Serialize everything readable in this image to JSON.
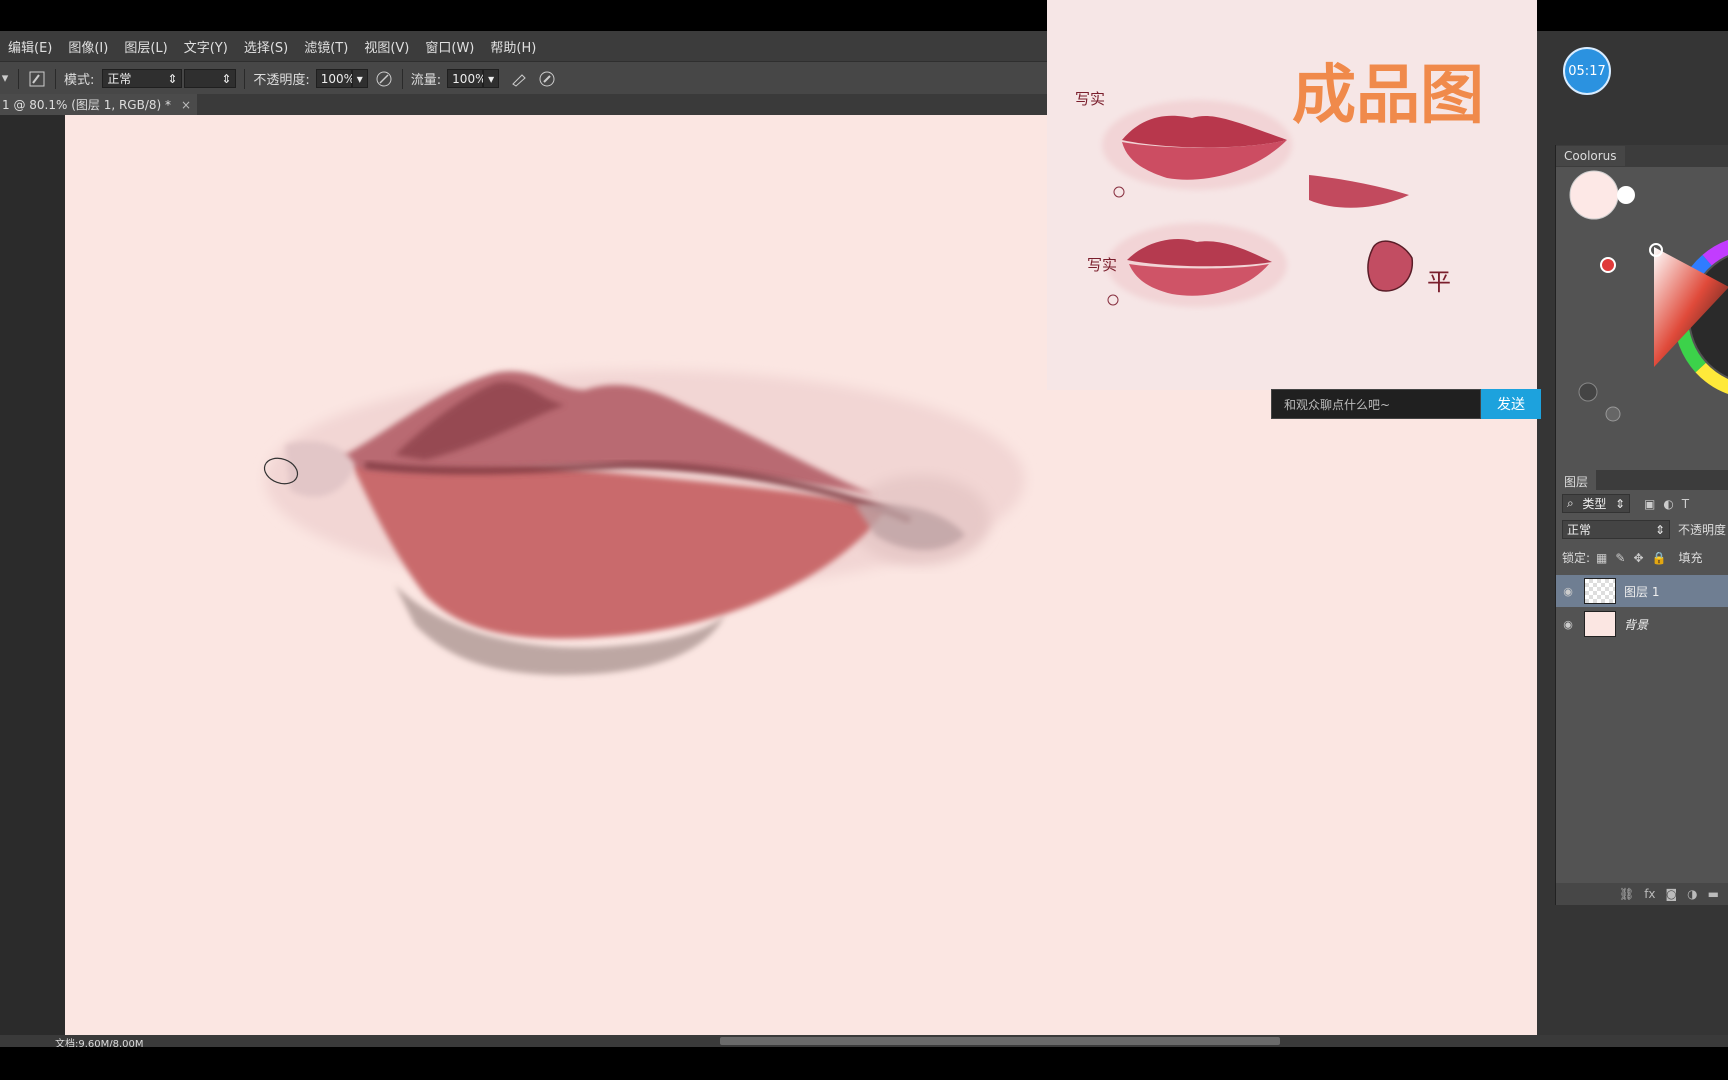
{
  "menu": [
    "编辑(E)",
    "图像(I)",
    "图层(L)",
    "文字(Y)",
    "选择(S)",
    "滤镜(T)",
    "视图(V)",
    "窗口(W)",
    "帮助(H)"
  ],
  "options": {
    "mode_label": "模式:",
    "mode_value": "正常",
    "opacity_label": "不透明度:",
    "opacity_value": "100%",
    "flow_label": "流量:",
    "flow_value": "100%"
  },
  "document_tab": {
    "title": "1 @ 80.1% (图层 1, RGB/8) *",
    "close": "×"
  },
  "status": {
    "doc_info": "文档:9.60M/8.00M"
  },
  "reference": {
    "title": "成品图",
    "label_realistic_1": "写实",
    "label_realistic_2": "写实",
    "label_flat": "平",
    "chat_placeholder": "和观众聊点什么吧~",
    "send_label": "发送"
  },
  "timer": "05:17",
  "colorus": {
    "tab": "Coolorus"
  },
  "layers_panel": {
    "tab": "图层",
    "filter_kind": "类型",
    "blend_mode": "正常",
    "opacity_label": "不透明度",
    "lock_label": "锁定:",
    "fill_label": "填充",
    "layers": [
      {
        "name": "图层 1",
        "selected": true
      },
      {
        "name": "背景",
        "selected": false
      }
    ]
  },
  "colors": {
    "canvas": "#fbe6e2",
    "accent_blue": "#1da2dd",
    "title_orange": "#f08a4b",
    "lip": "#c85a64"
  },
  "icons": [
    "brush-preset-icon",
    "airbrush-icon",
    "pressure-opacity-icon",
    "pressure-size-icon",
    "eye-icon",
    "link-icon",
    "fx-icon",
    "mask-icon",
    "adjustment-icon",
    "folder-icon",
    "lock-icon"
  ]
}
